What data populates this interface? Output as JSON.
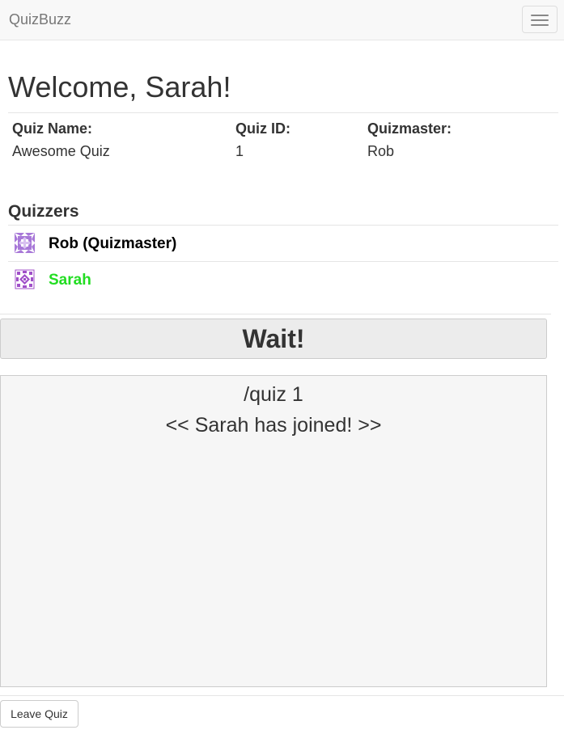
{
  "navbar": {
    "brand": "QuizBuzz",
    "menu_icon": "hamburger-menu-icon"
  },
  "welcome": "Welcome, Sarah!",
  "quiz_info": {
    "name_label": "Quiz Name:",
    "name_value": "Awesome Quiz",
    "id_label": "Quiz ID:",
    "id_value": "1",
    "master_label": "Quizmaster:",
    "master_value": "Rob"
  },
  "quizzers": {
    "title": "Quizzers",
    "list": [
      {
        "name": "Rob (Quizmaster)",
        "color": "#000000",
        "avatar_color": "#a878d8",
        "avatar_icon": "identicon-avatar-icon"
      },
      {
        "name": "Sarah",
        "color": "#22dd22",
        "avatar_color": "#a050c8",
        "avatar_icon": "identicon-avatar-icon"
      }
    ]
  },
  "buzzer": {
    "label": "Wait!"
  },
  "chat": {
    "lines": [
      "/quiz 1",
      "<< Sarah has joined! >>"
    ]
  },
  "leave_button": {
    "label": "Leave Quiz"
  }
}
